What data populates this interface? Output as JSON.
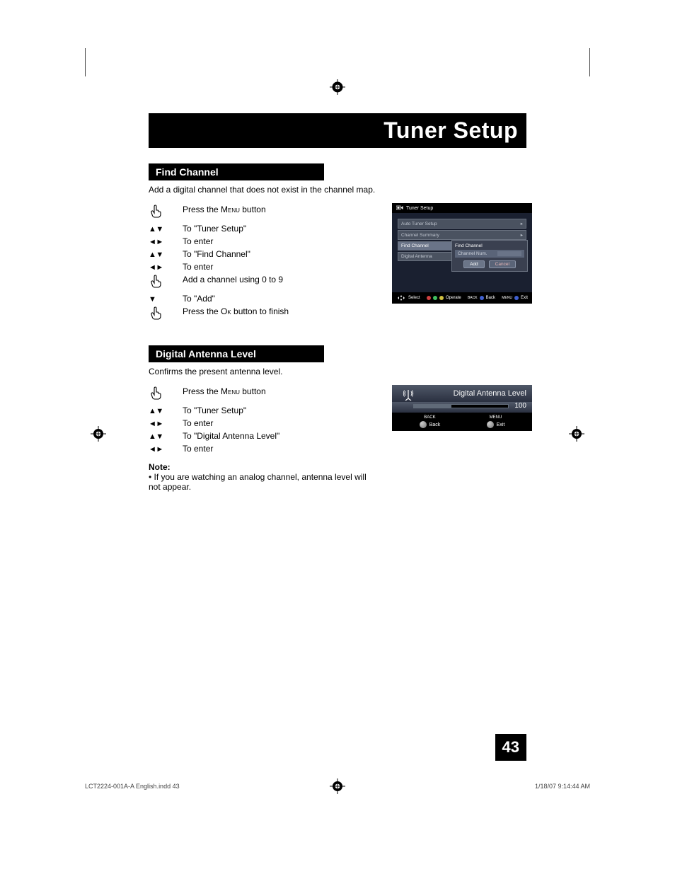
{
  "page_title": "Tuner Setup",
  "section_find_channel": {
    "heading": "Find Channel",
    "intro": "Add a digital channel that does not exist in the channel map.",
    "steps": [
      {
        "icon": "hand",
        "text_prefix": "Press the ",
        "text_sc": "Menu",
        "text_suffix": " button"
      },
      {
        "icon": "ud",
        "text": "To \"Tuner Setup\""
      },
      {
        "icon": "lr",
        "text": "To enter"
      },
      {
        "icon": "ud",
        "text": "To \"Find Channel\""
      },
      {
        "icon": "lr",
        "text": "To enter"
      },
      {
        "icon": "hand",
        "text": "Add a channel using 0 to 9"
      },
      {
        "icon": "d",
        "text": "To \"Add\""
      },
      {
        "icon": "hand",
        "text_prefix": "Press the ",
        "text_sc": "Ok",
        "text_suffix": " button to finish"
      }
    ]
  },
  "section_antenna": {
    "heading": "Digital Antenna Level",
    "intro": "Confirms the present antenna level.",
    "steps": [
      {
        "icon": "hand",
        "text_prefix": "Press the ",
        "text_sc": "Menu",
        "text_suffix": " button"
      },
      {
        "icon": "ud",
        "text": "To \"Tuner Setup\""
      },
      {
        "icon": "lr",
        "text": "To enter"
      },
      {
        "icon": "ud",
        "text": "To \"Digital Antenna Level\""
      },
      {
        "icon": "lr",
        "text": "To enter"
      }
    ],
    "note_label": "Note:",
    "note_body": "• If you are watching an analog channel, antenna level will not appear."
  },
  "osd1": {
    "title": "Tuner Setup",
    "items": [
      "Auto Tuner Setup",
      "Channel Summary",
      "Find Channel",
      "Digital Antenna"
    ],
    "popup_title": "Find Channel",
    "popup_field": "Channel Num.",
    "popup_value": " ",
    "btn_add": "Add",
    "btn_cancel": "Cancel",
    "footer_select": "Select",
    "footer_operate": "Operate",
    "footer_back_lbl": "BACK",
    "footer_back": "Back",
    "footer_menu_lbl": "MENU",
    "footer_exit": "Exit"
  },
  "osd2": {
    "title": "Digital Antenna Level",
    "value": "100",
    "back_top": "BACK",
    "back": "Back",
    "menu_top": "MENU",
    "exit": "Exit"
  },
  "page_number": "43",
  "footer_left": "LCT2224-001A-A English.indd   43",
  "footer_right": "1/18/07   9:14:44 AM"
}
